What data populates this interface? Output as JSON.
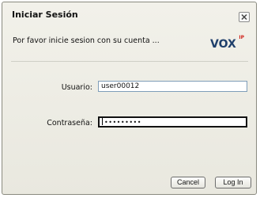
{
  "dialog": {
    "title": "Iniciar Sesión",
    "subtitle": "Por favor inicie sesion con su cuenta ...",
    "logo": {
      "text": "VOX",
      "accent": "IP",
      "icon": "vox-logo"
    },
    "close_icon": "close-icon",
    "fields": {
      "username": {
        "label": "Usuario:",
        "value": "user00012"
      },
      "password": {
        "label": "Contraseña:",
        "value": "•••••••••"
      }
    },
    "buttons": {
      "cancel": "Cancel",
      "login": "Log In"
    }
  },
  "colors": {
    "logo_blue": "#1f3f6b",
    "logo_red": "#d0241c",
    "input_border": "#7f9db9"
  }
}
